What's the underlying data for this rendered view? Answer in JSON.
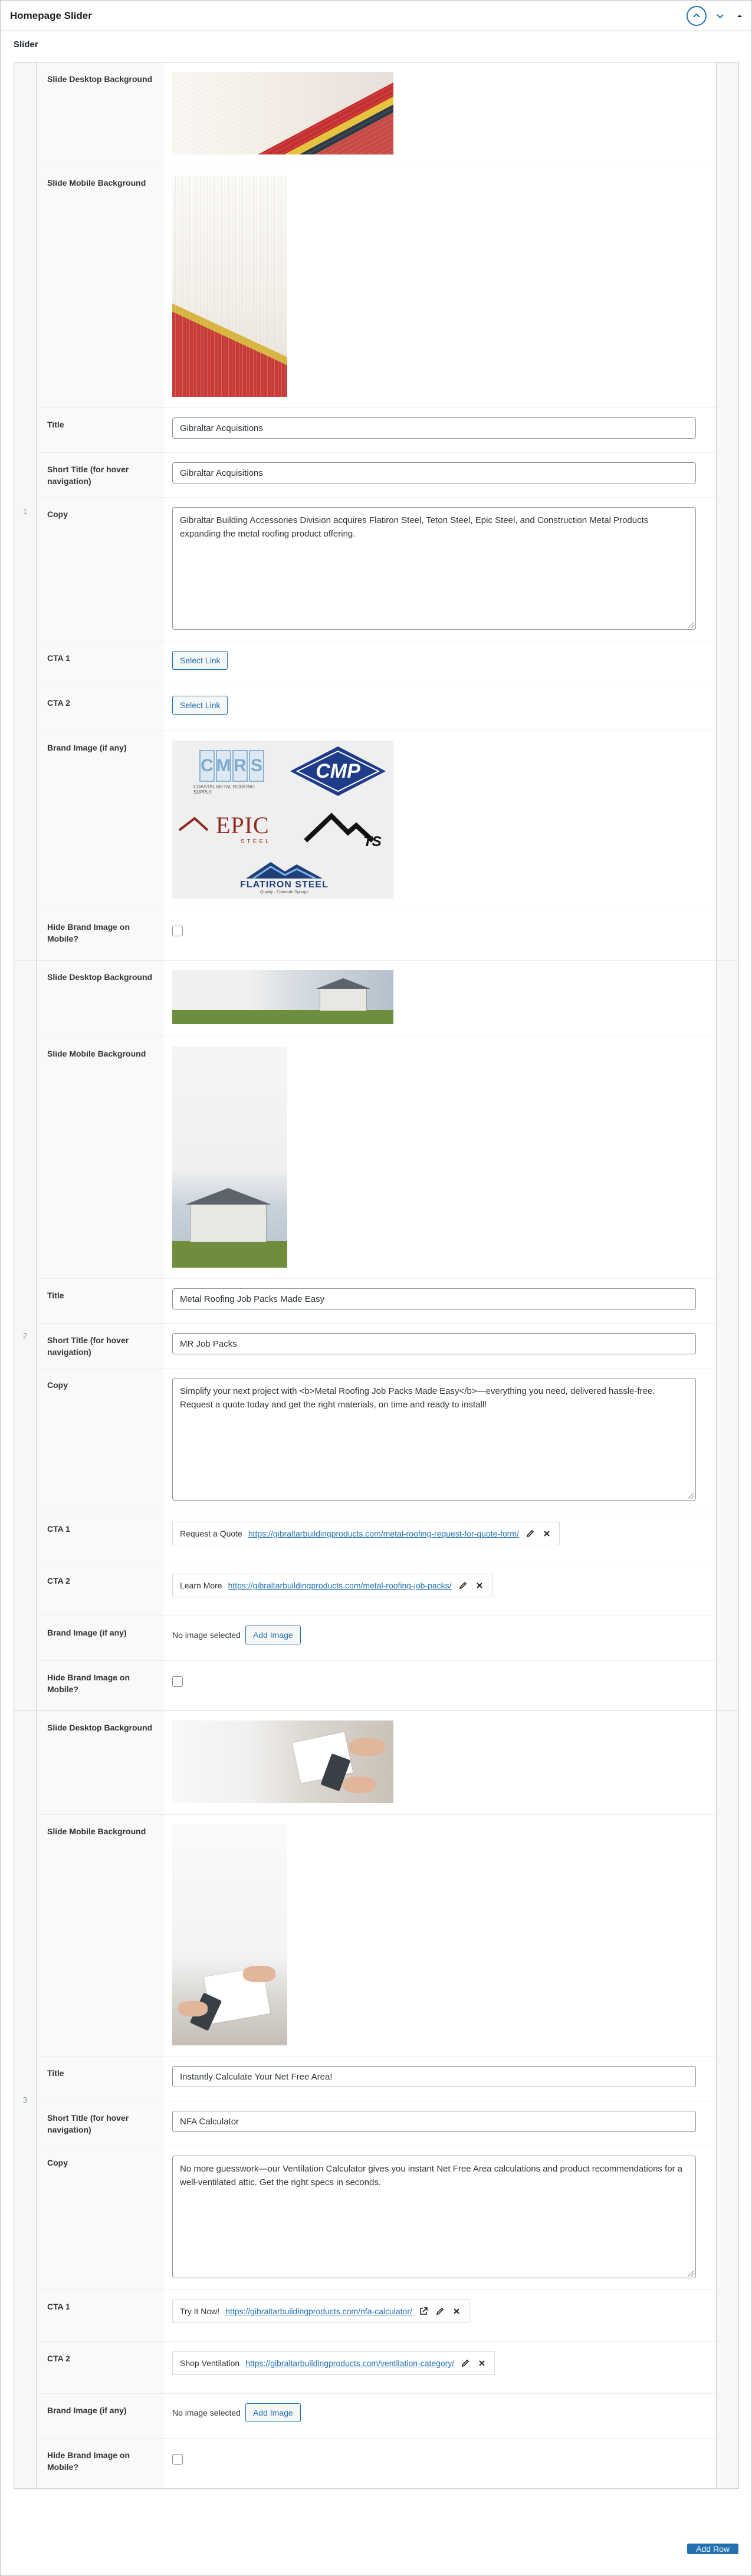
{
  "panel": {
    "title": "Homepage Slider"
  },
  "field_label": "Slider",
  "labels": {
    "desktop_bg": "Slide Desktop Background",
    "mobile_bg": "Slide Mobile Background",
    "title": "Title",
    "short_title": "Short Title (for hover navigation)",
    "copy": "Copy",
    "cta1": "CTA 1",
    "cta2": "CTA 2",
    "brand": "Brand Image (if any)",
    "hide_brand": "Hide Brand Image on Mobile?"
  },
  "common": {
    "select_link": "Select Link",
    "no_image": "No image selected",
    "add_image": "Add Image"
  },
  "slides": [
    {
      "index": "1",
      "title": "Gibraltar Acquisitions",
      "short_title": "Gibraltar Acquisitions",
      "copy": "Gibraltar Building Accessories Division acquires Flatiron Steel, Teton Steel, Epic Steel, and Construction Metal Products expanding the metal roofing product offering.",
      "brands": {
        "cmrs": "CMRS",
        "cmrs_sub": "COASTAL METAL ROOFING SUPPLY",
        "cmp": "CMP",
        "epic": "EPIC",
        "epic_sub": "STEEL",
        "ts": "TS",
        "flatiron": "FLATIRON STEEL",
        "flatiron_sub": "Quality · Colorado Springs"
      }
    },
    {
      "index": "2",
      "title": "Metal Roofing Job Packs Made Easy",
      "short_title": "MR Job Packs",
      "copy": "Simplify your next project with <b>Metal Roofing Job Packs Made Easy</b>—everything you need, delivered hassle-free. Request a quote today and get the right materials, on time and ready to install!",
      "cta1": {
        "title": "Request a Quote",
        "url": "https://gibraltarbuildingproducts.com/metal-roofing-request-for-quote-form/"
      },
      "cta2": {
        "title": "Learn More",
        "url": "https://gibraltarbuildingproducts.com/metal-roofing-job-packs/"
      }
    },
    {
      "index": "3",
      "title": "Instantly Calculate Your Net Free Area!",
      "short_title": "NFA Calculator",
      "copy": "No more guesswork—our Ventilation Calculator gives you instant Net Free Area calculations and product recommendations for a well-ventilated attic. Get the right specs in seconds.",
      "cta1": {
        "title": "Try It Now!",
        "url": "https://gibraltarbuildingproducts.com/nfa-calculator/"
      },
      "cta2": {
        "title": "Shop Ventilation",
        "url": "https://gibraltarbuildingproducts.com/ventilation-category/"
      }
    }
  ],
  "add_row": "Add Row",
  "colors": {
    "accent": "#2271b1",
    "border": "#c3c4c7"
  }
}
